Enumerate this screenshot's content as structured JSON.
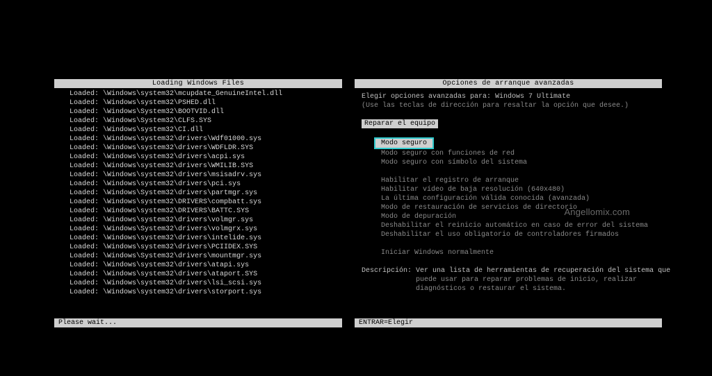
{
  "left": {
    "title": "Loading Windows Files",
    "please_wait": "Please wait...",
    "loaded_prefix": "Loaded:",
    "files": [
      "\\Windows\\system32\\mcupdate_GenuineIntel.dll",
      "\\Windows\\system32\\PSHED.dll",
      "\\Windows\\System32\\BOOTVID.dll",
      "\\Windows\\System32\\CLFS.SYS",
      "\\Windows\\system32\\CI.dll",
      "\\Windows\\system32\\drivers\\Wdf01000.sys",
      "\\Windows\\system32\\drivers\\WDFLDR.SYS",
      "\\Windows\\system32\\drivers\\acpi.sys",
      "\\Windows\\system32\\drivers\\WMILIB.SYS",
      "\\Windows\\system32\\drivers\\msisadrv.sys",
      "\\Windows\\system32\\drivers\\pci.sys",
      "\\Windows\\System32\\drivers\\partmgr.sys",
      "\\Windows\\system32\\DRIVERS\\compbatt.sys",
      "\\Windows\\system32\\DRIVERS\\BATTC.SYS",
      "\\Windows\\system32\\drivers\\volmgr.sys",
      "\\Windows\\System32\\drivers\\volmgrx.sys",
      "\\Windows\\system32\\drivers\\intelide.sys",
      "\\Windows\\system32\\drivers\\PCIIDEX.SYS",
      "\\Windows\\System32\\drivers\\mountmgr.sys",
      "\\Windows\\system32\\drivers\\atapi.sys",
      "\\Windows\\system32\\drivers\\ataport.SYS",
      "\\Windows\\system32\\drivers\\lsi_scsi.sys",
      "\\Windows\\system32\\drivers\\storport.sys"
    ]
  },
  "right": {
    "title": "Opciones de arranque avanzadas",
    "choose_for": "Elegir opciones avanzadas para:",
    "os_name": "Windows 7 Ultimate",
    "hint": "(Use las teclas de dirección para resaltar la opción que desee.)",
    "repair": "Reparar el equipo",
    "selected": "Modo seguro",
    "options": [
      "Modo seguro con funciones de red",
      "Modo seguro con símbolo del sistema",
      "",
      "Habilitar el registro de arranque",
      "Habilitar vídeo de baja resolución (640x480)",
      "La última configuración válida conocida (avanzada)",
      "Modo de restauración de servicios de directorio",
      "Modo de depuración",
      "Deshabilitar el reinicio automático en caso de error del sistema",
      "Deshabilitar el uso obligatorio de controladores firmados",
      "",
      "Iniciar Windows normalmente"
    ],
    "desc_label": "Descripción:",
    "desc_1": "Ver una lista de herramientas de recuperación del sistema que",
    "desc_2": "puede usar para reparar problemas de inicio, realizar",
    "desc_3": "diagnósticos o restaurar el sistema.",
    "footer": "ENTRAR=Elegir",
    "watermark": "Angellomix.com"
  }
}
